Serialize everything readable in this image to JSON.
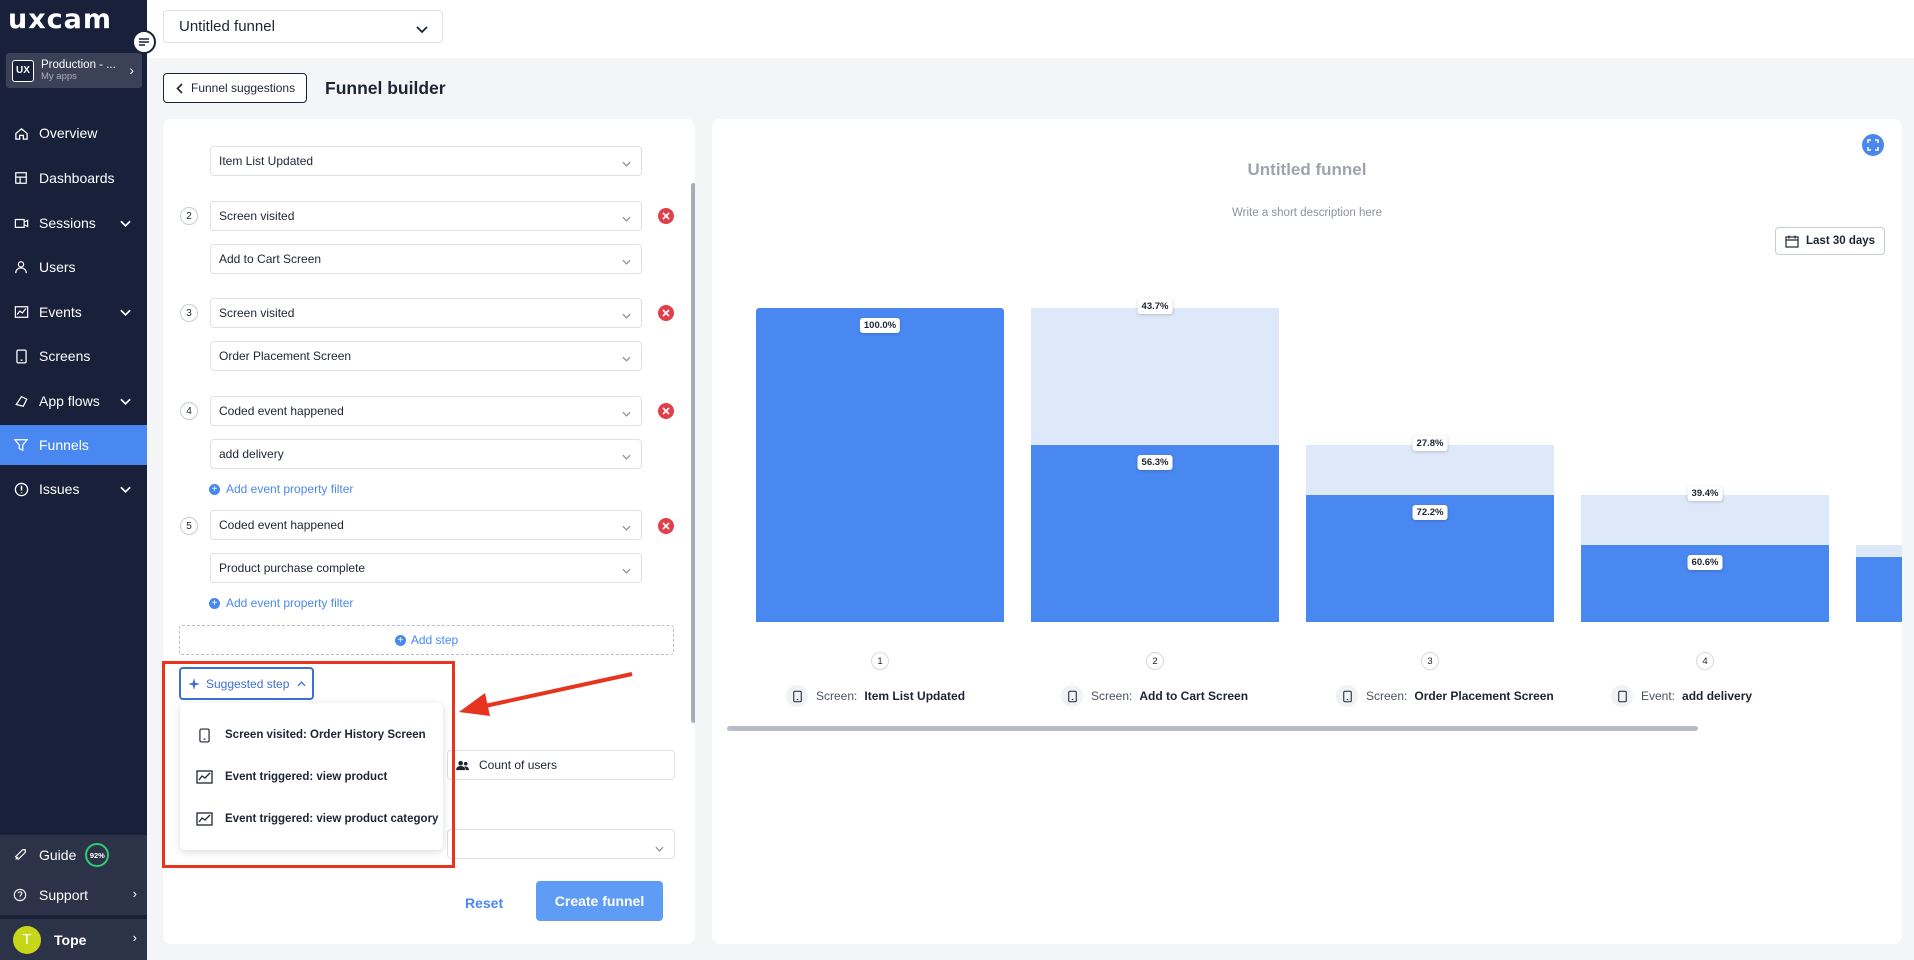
{
  "brand": {
    "logo": "uxcam"
  },
  "app_switcher": {
    "badge": "UX",
    "name": "Production - ...",
    "sub": "My apps"
  },
  "nav": [
    {
      "label": "Overview",
      "icon": "home-icon"
    },
    {
      "label": "Dashboards",
      "icon": "dashboard-icon"
    },
    {
      "label": "Sessions",
      "icon": "sessions-icon",
      "expandable": true
    },
    {
      "label": "Users",
      "icon": "user-icon"
    },
    {
      "label": "Events",
      "icon": "events-icon",
      "expandable": true
    },
    {
      "label": "Screens",
      "icon": "phone-icon"
    },
    {
      "label": "App flows",
      "icon": "flow-icon",
      "expandable": true
    },
    {
      "label": "Funnels",
      "icon": "funnel-icon",
      "active": true
    },
    {
      "label": "Issues",
      "icon": "alert-icon",
      "expandable": true
    }
  ],
  "bottom_nav": {
    "guide": {
      "label": "Guide",
      "progress": "92%"
    },
    "support": {
      "label": "Support"
    },
    "user": {
      "initial": "T",
      "name": "Tope"
    }
  },
  "topbar": {
    "funnel_name": "Untitled funnel"
  },
  "header": {
    "back_label": "Funnel suggestions",
    "title": "Funnel builder"
  },
  "builder": {
    "step1_value": "Item List Updated",
    "steps": [
      {
        "num": "2",
        "type": "Screen visited",
        "value": "Add to Cart Screen"
      },
      {
        "num": "3",
        "type": "Screen visited",
        "value": "Order Placement Screen"
      },
      {
        "num": "4",
        "type": "Coded event happened",
        "value": "add delivery",
        "filter": "Add event property filter"
      },
      {
        "num": "5",
        "type": "Coded event happened",
        "value": "Product purchase complete",
        "filter": "Add event property filter"
      }
    ],
    "add_step": "Add step",
    "suggested_step": "Suggested step",
    "suggestions": [
      {
        "label": "Screen visited: Order History Screen",
        "icon": "phone-icon"
      },
      {
        "label": "Event triggered: view product",
        "icon": "event-chart-icon"
      },
      {
        "label": "Event triggered: view product category",
        "icon": "event-chart-icon"
      }
    ],
    "count_of_users": "Count of users",
    "reset": "Reset",
    "create": "Create funnel"
  },
  "chart_panel": {
    "title": "Untitled funnel",
    "description": "Write a short description here",
    "date_range": "Last 30 days"
  },
  "chart_data": {
    "type": "bar",
    "title": "Untitled funnel",
    "categories": [
      "1",
      "2",
      "3",
      "4"
    ],
    "series": [
      {
        "name": "converted",
        "values": [
          100.0,
          56.3,
          40.6,
          24.6
        ]
      },
      {
        "name": "dropped",
        "values": [
          0,
          43.7,
          15.7,
          16.0
        ]
      }
    ],
    "conversion_labels": [
      "100.0%",
      "56.3%",
      "72.2%",
      "60.6%"
    ],
    "dropoff_labels": [
      "",
      "43.7%",
      "27.8%",
      "39.4%"
    ],
    "step_captions": [
      {
        "type": "Screen:",
        "name": "Item List Updated",
        "icon": "phone-icon"
      },
      {
        "type": "Screen:",
        "name": "Add to Cart Screen",
        "icon": "phone-icon"
      },
      {
        "type": "Screen:",
        "name": "Order Placement Screen",
        "icon": "phone-icon"
      },
      {
        "type": "Event:",
        "name": "add delivery",
        "icon": "event-icon"
      }
    ],
    "ylim": [
      0,
      100
    ]
  }
}
